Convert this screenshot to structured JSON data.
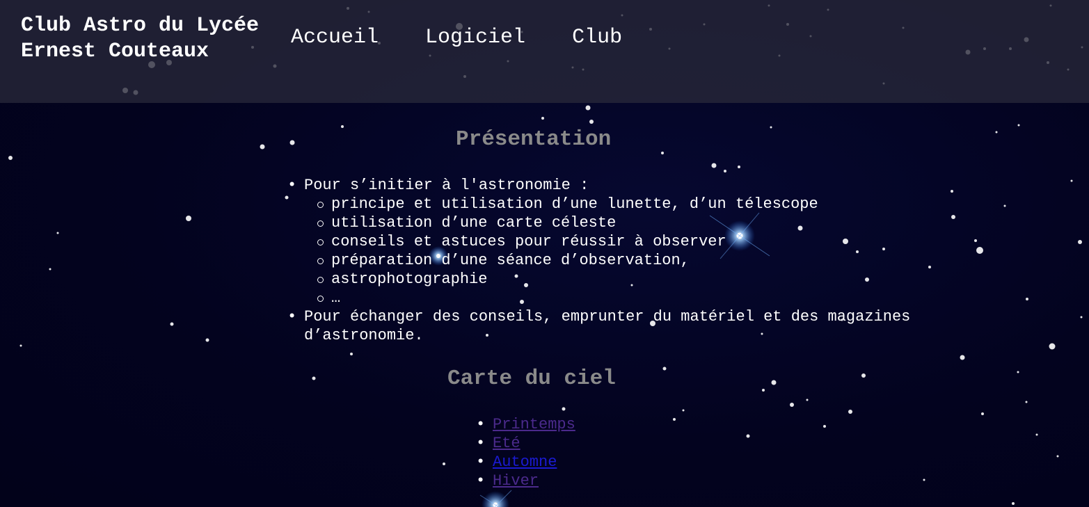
{
  "header": {
    "site_title_line1": "Club Astro du Lycée",
    "site_title_line2": "Ernest Couteaux",
    "nav": [
      {
        "label": "Accueil"
      },
      {
        "label": "Logiciel"
      },
      {
        "label": "Club"
      }
    ]
  },
  "presentation": {
    "title": "Présentation",
    "items": [
      {
        "text": "Pour s’initier à l'astronomie :",
        "subitems": [
          "principe et utilisation d’une lunette, d’un télescope",
          "utilisation d’une carte céleste",
          "conseils et astuces pour réussir à observer",
          "préparation d’une séance d’observation,",
          "astrophotographie",
          "…"
        ]
      },
      {
        "text": "Pour échanger des conseils, emprunter du matériel et des magazines d’astronomie."
      }
    ]
  },
  "sky_map": {
    "title": "Carte du ciel",
    "links": [
      {
        "label": "Printemps",
        "state": "visited"
      },
      {
        "label": "Eté",
        "state": "visited"
      },
      {
        "label": "Automne",
        "state": "unvisited"
      },
      {
        "label": "Hiver",
        "state": "visited"
      }
    ]
  },
  "colors": {
    "header_bg": "#2a2a3a",
    "page_bg": "#03031a",
    "heading": "#8a8a8a",
    "text": "#ffffff",
    "link_visited": "#4b2a8c",
    "link_unvisited": "#1a1ad0"
  }
}
